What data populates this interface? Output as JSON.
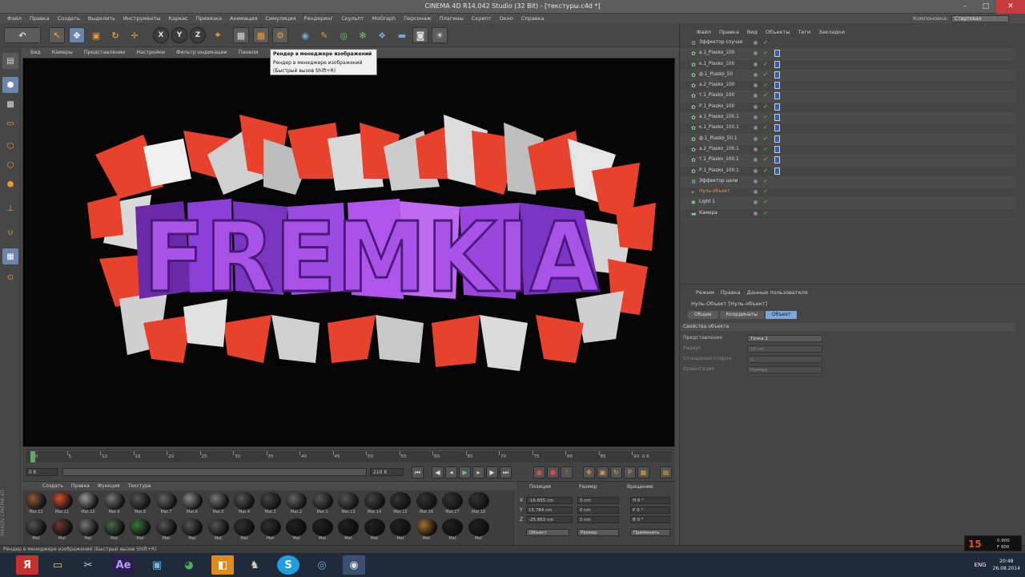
{
  "titlebar": {
    "title": "CINEMA 4D R14.042 Studio (32 Bit) - [текстуры.c4d *]",
    "min": "–",
    "max": "□",
    "close": "✕"
  },
  "menubar": {
    "items": [
      "Файл",
      "Правка",
      "Создать",
      "Выделить",
      "Инструменты",
      "Каркас",
      "Привязка",
      "Анимация",
      "Симуляция",
      "Рендеринг",
      "Скульпт",
      "MoGraph",
      "Персонаж",
      "Плагины",
      "Скрипт",
      "Окно",
      "Справка"
    ],
    "layout_label": "Компоновка:",
    "layout_value": "Стартовая"
  },
  "viewport_menu": {
    "items": [
      "Вид",
      "Камеры",
      "Представление",
      "Настройки",
      "Фильтр индикации",
      "Панели"
    ]
  },
  "tooltip": {
    "line1": "Рендер в менеджере изображений",
    "line2": "Рендер в менеджере изображений",
    "line3": "(Быстрый вызов Shift+R)"
  },
  "scene_text": "FREMKIA",
  "timeline": {
    "ticks": [
      "0",
      "5",
      "10",
      "15",
      "20",
      "25",
      "30",
      "35",
      "40",
      "45",
      "50",
      "55",
      "60",
      "65",
      "70",
      "75",
      "80",
      "85",
      "90"
    ],
    "end_label": "0 K"
  },
  "transport": {
    "start_frame": "0 K",
    "end_frame": "210 K",
    "range_end": "210 K"
  },
  "materials": {
    "menu": [
      "Создать",
      "Правка",
      "Функция",
      "Текстура"
    ],
    "row1": [
      "Mat.12",
      "Mat.11",
      "Mat.10",
      "Mat.9",
      "Mat.8",
      "Mat.7",
      "Mat.6",
      "Mat.5",
      "Mat.4",
      "Mat.3",
      "Mat.2",
      "Mat.1",
      "Mat.13",
      "Mat.14",
      "Mat.15",
      "Mat.16",
      "Mat.17",
      "Mat.18"
    ],
    "row2": [
      "Mat",
      "Mat",
      "Mat",
      "Mat",
      "Mat",
      "Mat",
      "Mat",
      "Mat",
      "Mat",
      "Mat",
      "Mat",
      "Mat",
      "Mat",
      "Mat",
      "Mat",
      "Mat",
      "Mat",
      "Mat"
    ]
  },
  "coords": {
    "headers": [
      "Позиция",
      "Размер",
      "Вращение"
    ],
    "axes": [
      "X",
      "Y",
      "Z"
    ],
    "pos": [
      "-16.655 cm",
      "15.784 cm",
      "-25.863 cm"
    ],
    "size": [
      "0 cm",
      "0 cm",
      "0 cm"
    ],
    "rot": [
      "H 0 °",
      "P 0 °",
      "B 0 °"
    ],
    "mode1": "Объект",
    "mode2": "Размер",
    "apply": "Применить"
  },
  "status": {
    "text": "Рендер в менеджере изображений (Быстрый вызов Shift+R)"
  },
  "side_label": "MAXON CINEMA 4D",
  "object_manager": {
    "menu": [
      "Файл",
      "Правка",
      "Вид",
      "Объекты",
      "Теги",
      "Закладки"
    ],
    "rows": [
      {
        "name": "Эффектор случая",
        "type": "effector"
      },
      {
        "name": "а.1_Plasko_100",
        "type": "obj"
      },
      {
        "name": "к.1_Plasko_100",
        "type": "obj"
      },
      {
        "name": "ф.1_Plasko_50",
        "type": "obj"
      },
      {
        "name": "а.2_Plasko_100",
        "type": "obj"
      },
      {
        "name": "т.1_Plasko_100",
        "type": "obj"
      },
      {
        "name": "Р.1_Plasko_100",
        "type": "obj"
      },
      {
        "name": "а.1_Plasko_100.1",
        "type": "obj"
      },
      {
        "name": "к.1_Plasko_100.1",
        "type": "obj"
      },
      {
        "name": "ф.1_Plasko_50.1",
        "type": "obj"
      },
      {
        "name": "а.2_Plasko_100.1",
        "type": "obj"
      },
      {
        "name": "т.1_Plasko_100.1",
        "type": "obj"
      },
      {
        "name": "Р.1_Plasko_100.1",
        "type": "obj"
      },
      {
        "name": "Эффектор цели",
        "type": "effector"
      },
      {
        "name": "Нуль-объект",
        "type": "null"
      },
      {
        "name": "Light 1",
        "type": "light"
      },
      {
        "name": "Камера",
        "type": "camera"
      }
    ]
  },
  "attr_manager": {
    "menu": [
      "Режим",
      "Правка",
      "Данные пользователя"
    ],
    "title": "Нуль-Объект [Нуль-объект]",
    "tabs": [
      "Общие",
      "Координаты",
      "Объект"
    ],
    "active_tab": "Объект",
    "section": "Свойства объекта",
    "rows": [
      {
        "label": "Представление",
        "value": "Точка 1",
        "dim": false
      },
      {
        "label": "Радиус",
        "value": "10 cm",
        "dim": true
      },
      {
        "label": "Отношение сторон",
        "value": "1",
        "dim": true
      },
      {
        "label": "Ориентация",
        "value": "Камера",
        "dim": true
      }
    ]
  },
  "taskbar": {
    "lang": "ENG",
    "time": "20:48",
    "date": "26.08.2014"
  },
  "fps": {
    "value": "15",
    "line1": "0.900",
    "line2": "F 900"
  },
  "colors": {
    "accent": "#7fa4d6",
    "extrude_red": "#e8412c",
    "letter_purple": "#8b3fd6",
    "taskbar": "#1f2b3a"
  }
}
